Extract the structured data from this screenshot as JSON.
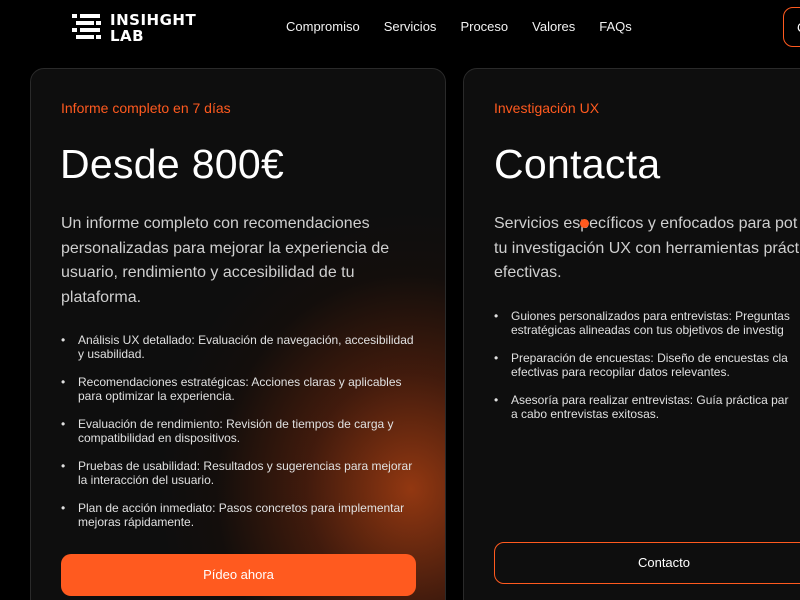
{
  "brand": {
    "name_line1": "INSIHGHT",
    "name_line2": "LAB"
  },
  "nav": [
    {
      "label": "Compromiso"
    },
    {
      "label": "Servicios"
    },
    {
      "label": "Proceso"
    },
    {
      "label": "Valores"
    },
    {
      "label": "FAQs"
    }
  ],
  "header_button": {
    "label": "C"
  },
  "cards": [
    {
      "eyebrow": "Informe completo en 7 días",
      "price": "Desde 800€",
      "description": "Un informe completo con recomendaciones personalizadas para mejorar la experiencia de usuario, rendimiento y accesibilidad de tu plataforma.",
      "features": [
        "Análisis UX detallado: Evaluación de navegación, accesibilidad y usabilidad.",
        "Recomendaciones estratégicas: Acciones claras y aplicables para optimizar la experiencia.",
        "Evaluación de rendimiento: Revisión de tiempos de carga y compatibilidad en dispositivos.",
        "Pruebas de usabilidad: Resultados y sugerencias para mejorar la interacción del usuario.",
        "Plan de acción inmediato: Pasos concretos para implementar mejoras rápidamente."
      ],
      "cta": "Pídeo ahora"
    },
    {
      "eyebrow": "Investigación UX",
      "price": "Contacta",
      "description_lines": [
        "Servicios específicos y enfocados para pot",
        "tu investigación UX con herramientas práct",
        "efectivas."
      ],
      "features": [
        {
          "line1": "Guiones personalizados para entrevistas: Preguntas",
          "line2": "estratégicas alineadas con tus objetivos de investig"
        },
        {
          "line1": "Preparación de encuestas: Diseño de encuestas cla",
          "line2": "efectivas para recopilar datos relevantes."
        },
        {
          "line1": "Asesoría para realizar entrevistas: Guía práctica par",
          "line2": "a cabo entrevistas exitosas."
        }
      ],
      "cta": "Contacto"
    }
  ],
  "colors": {
    "accent": "#ff5a1f",
    "background": "#000000",
    "card": "#0e0e0e"
  }
}
